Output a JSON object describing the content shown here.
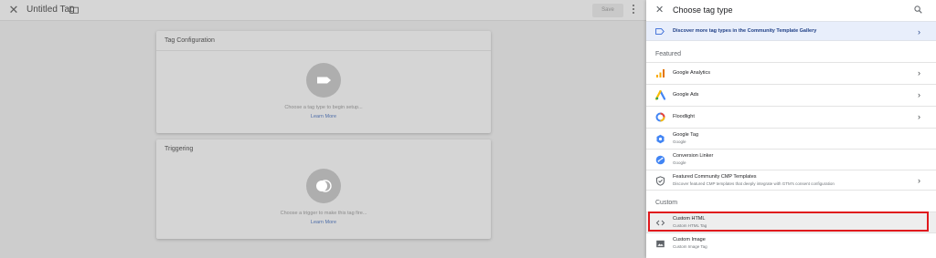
{
  "editor": {
    "title": "Untitled Tag",
    "save_label": "Save",
    "tag_config": {
      "label": "Tag Configuration",
      "prompt": "Choose a tag type to begin setup...",
      "learn_more": "Learn More"
    },
    "triggering": {
      "label": "Triggering",
      "prompt": "Choose a trigger to make this tag fire...",
      "learn_more": "Learn More"
    }
  },
  "panel": {
    "title": "Choose tag type",
    "discover": "Discover more tag types in the Community Template Gallery",
    "featured_label": "Featured",
    "custom_label": "Custom",
    "featured": [
      {
        "name": "Google Analytics",
        "sub": "",
        "icon": "google-analytics-icon",
        "chevron": true
      },
      {
        "name": "Google Ads",
        "sub": "",
        "icon": "google-ads-icon",
        "chevron": true
      },
      {
        "name": "Floodlight",
        "sub": "",
        "icon": "floodlight-icon",
        "chevron": true
      },
      {
        "name": "Google Tag",
        "sub": "Google",
        "icon": "google-tag-icon",
        "chevron": false
      },
      {
        "name": "Conversion Linker",
        "sub": "Google",
        "icon": "conversion-linker-icon",
        "chevron": false
      },
      {
        "name": "Featured Community CMP Templates",
        "sub": "Discover featured CMP templates that deeply integrate with GTM's consent configuration",
        "icon": "shield-check-icon",
        "chevron": true
      }
    ],
    "custom": [
      {
        "name": "Custom HTML",
        "sub": "Custom HTML Tag",
        "icon": "code-icon",
        "highlighted": true
      },
      {
        "name": "Custom Image",
        "sub": "Custom Image Tag",
        "icon": "image-icon",
        "highlighted": false
      }
    ]
  },
  "colors": {
    "highlight_border": "#e0191d",
    "discover_bg": "#e8eefb",
    "link": "#4e6ea8"
  }
}
